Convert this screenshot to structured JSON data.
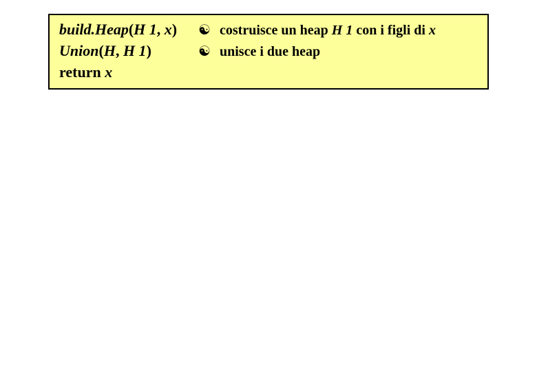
{
  "box": {
    "lines": [
      {
        "code": {
          "fn": "build.Heap",
          "args_open": "(",
          "arg1": "H 1",
          "sep": ", ",
          "arg2": "x",
          "args_close": ")"
        },
        "comment": {
          "tick": "☯",
          "pre": " costruisce un heap ",
          "em1": "H 1",
          "mid": " con i figli di ",
          "em2": "x"
        }
      },
      {
        "code": {
          "fn": "Union",
          "args_open": "(",
          "arg1": "H",
          "sep": ", ",
          "arg2": "H 1",
          "args_close": ")"
        },
        "comment": {
          "tick": "☯",
          "pre": " unisce i due heap",
          "em1": "",
          "mid": "",
          "em2": ""
        }
      },
      {
        "code": {
          "fn": "return ",
          "args_open": "",
          "arg1": "x",
          "sep": "",
          "arg2": "",
          "args_close": ""
        },
        "comment": {
          "tick": "",
          "pre": "",
          "em1": "",
          "mid": "",
          "em2": ""
        }
      }
    ]
  }
}
